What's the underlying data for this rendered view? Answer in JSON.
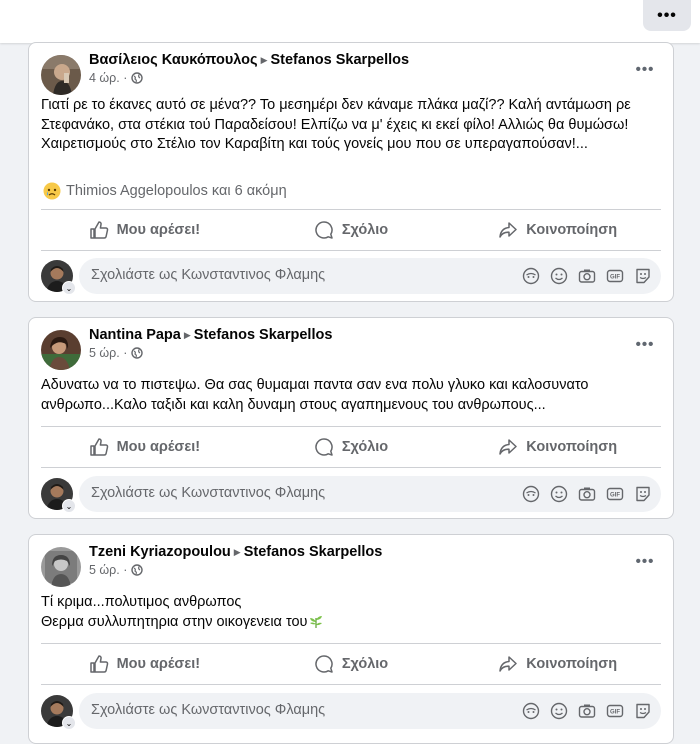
{
  "topbar": {
    "more_label": "•••"
  },
  "posts": [
    {
      "author": "Βασίλειος Καυκόπουλος",
      "target": "Stefanos Skarpellos",
      "time": "4 ώρ. ·",
      "text": "Γιατί ρε το έκανες αυτό σε μένα?? Το μεσημέρι δεν κάναμε πλάκα μαζί?? Καλή αντάμωση ρε Στεφανάκο, στα στέκια τού Παραδείσου! Ελπίζω να μ' έχεις κι εκεί φίλο! Αλλιώς θα θυμώσω! Χαιρετισμούς στο Στέλιο τον Καραβίτη και τούς γονείς μου που σε υπεραγαπούσαν!...",
      "reactions": "Thimios Aggelopoulos και 6 ακόμη"
    },
    {
      "author": "Nantina Papa",
      "target": "Stefanos Skarpellos",
      "time": "5 ώρ. ·",
      "text": "Αδυνατω να το πιστεψω.  Θα σας θυμαμαι παντα σαν ενα πολυ γλυκο και καλοσυνατο ανθρωπο...Καλο ταξιδι και καλη δυναμη στους αγαπημενους του ανθρωπους..."
    },
    {
      "author": "Tzeni Kyriazopoulou",
      "target": "Stefanos Skarpellos",
      "time": "5 ώρ. ·",
      "text_line1": "Τί κριμα...πολυτιμος ανθρωπος",
      "text_line2": "Θερμα συλλυπητηρια στην οικογενεια του"
    }
  ],
  "actions": {
    "like": "Μου αρέσει!",
    "comment": "Σχόλιο",
    "share": "Κοινοποίηση"
  },
  "comment_placeholder": "Σχολιάστε ως Κωνσταντινος Φλαμης",
  "colors": {
    "secondary_text": "#65676b",
    "card_border": "#ced0d4",
    "page_bg": "#f0f2f5"
  }
}
